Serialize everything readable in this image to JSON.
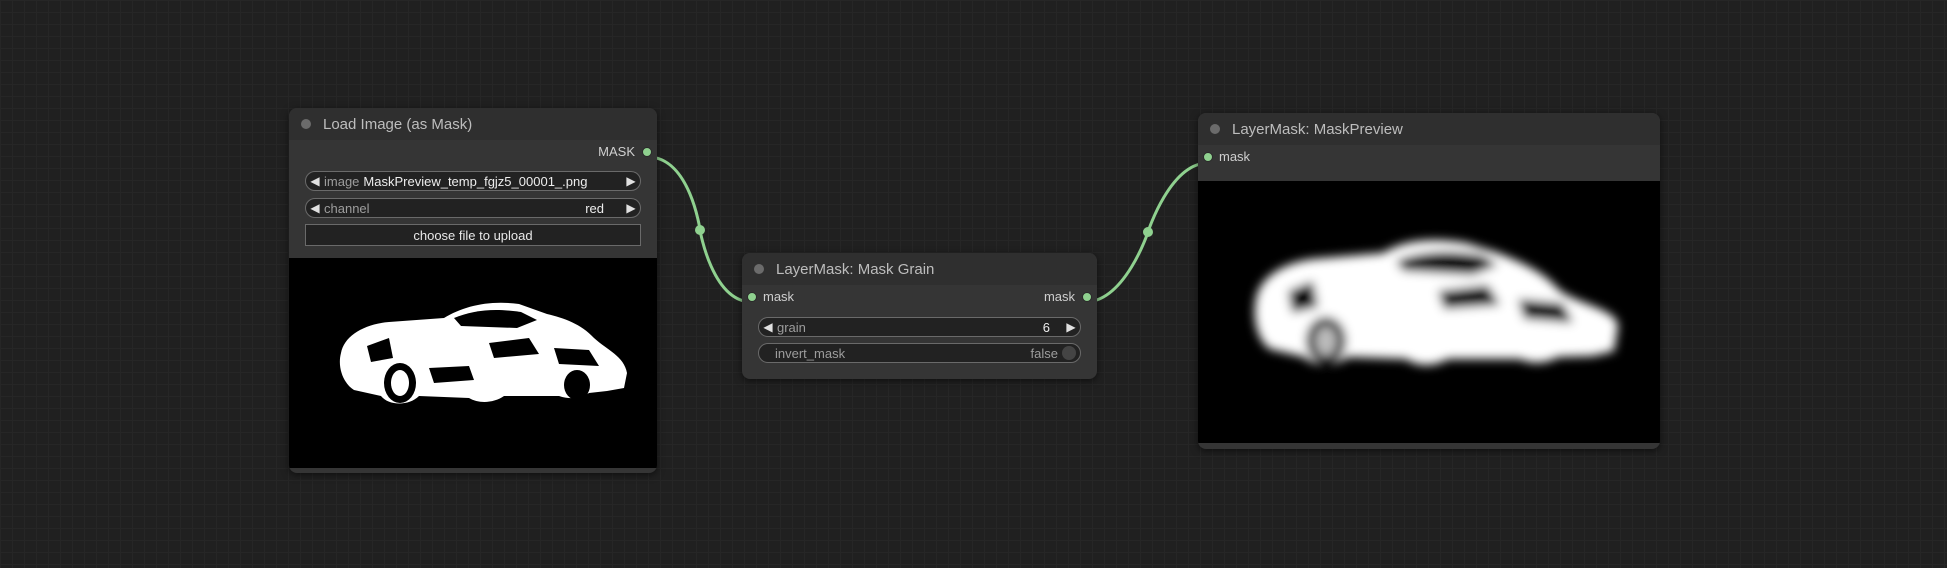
{
  "nodes": {
    "load_image": {
      "title": "Load Image (as Mask)",
      "output_label": "MASK",
      "image_widget": {
        "label": "image",
        "value": "MaskPreview_temp_fgjz5_00001_.png"
      },
      "channel_widget": {
        "label": "channel",
        "value": "red"
      },
      "upload_label": "choose file to upload"
    },
    "mask_grain": {
      "title": "LayerMask: Mask Grain",
      "input_label": "mask",
      "output_label": "mask",
      "grain_widget": {
        "label": "grain",
        "value": "6"
      },
      "invert_widget": {
        "label": "invert_mask",
        "value": "false"
      }
    },
    "mask_preview": {
      "title": "LayerMask: MaskPreview",
      "input_label": "mask"
    }
  },
  "colors": {
    "canvas_bg": "#202020",
    "node_bg": "#353535",
    "title_bg": "#2f2f2f",
    "link": "#8fd18f",
    "slot": "#8fd18f"
  },
  "icons": {
    "left_arrow": "◀",
    "right_arrow": "▶"
  }
}
